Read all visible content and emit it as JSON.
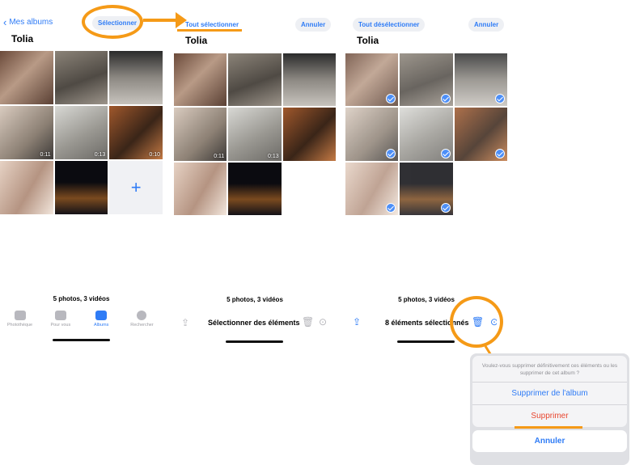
{
  "screen1": {
    "back_label": "Mes albums",
    "select_button": "Sélectionner",
    "title": "Tolia",
    "count": "5 photos, 3 vidéos",
    "tabs": [
      "Photothèque",
      "Pour vous",
      "Albums",
      "Rechercher"
    ],
    "durations": [
      "0:11",
      "0:13",
      "0:10"
    ]
  },
  "screen2": {
    "select_all": "Tout sélectionner",
    "cancel": "Annuler",
    "title": "Tolia",
    "count": "5 photos, 3 vidéos",
    "toolbar_label": "Sélectionner des éléments",
    "durations": [
      "0:11",
      "0:13"
    ]
  },
  "screen3": {
    "deselect_all": "Tout désélectionner",
    "cancel": "Annuler",
    "title": "Tolia",
    "count": "5 photos, 3 vidéos",
    "toolbar_label": "8 éléments sélectionnés"
  },
  "sheet": {
    "message": "Voulez-vous supprimer définitivement ces éléments ou les supprimer de cet album ?",
    "remove_from_album": "Supprimer de l'album",
    "delete": "Supprimer",
    "cancel": "Annuler"
  },
  "colors": {
    "accent": "#2f7cf6",
    "annotation": "#f59a17",
    "destructive": "#e8462f"
  }
}
